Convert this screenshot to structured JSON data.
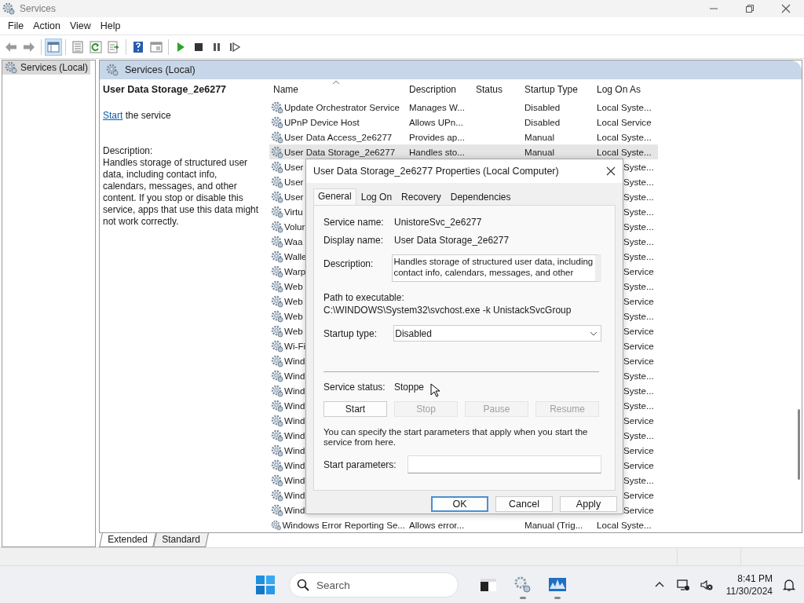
{
  "window": {
    "title": "Services"
  },
  "menu": [
    "File",
    "Action",
    "View",
    "Help"
  ],
  "toolbar": [
    {
      "kind": "back",
      "selected": false
    },
    {
      "kind": "forward",
      "selected": false
    },
    {
      "kind": "tree",
      "selected": true
    },
    {
      "kind": "list",
      "selected": false
    },
    {
      "kind": "refresh",
      "selected": false
    },
    {
      "kind": "export",
      "selected": false
    },
    {
      "kind": "help",
      "selected": false
    },
    {
      "kind": "view",
      "selected": false
    },
    {
      "kind": "play",
      "selected": false
    },
    {
      "kind": "stop",
      "selected": false
    },
    {
      "kind": "pause",
      "selected": false
    },
    {
      "kind": "resume",
      "selected": false
    }
  ],
  "tree": [
    {
      "label": "Services (Local)",
      "selected": true
    }
  ],
  "details": {
    "header": "Services (Local)",
    "service_title": "User Data Storage_2e6277",
    "action_link": "Start",
    "action_text": "the service",
    "description_label": "Description:",
    "description": "Handles storage of structured user data, including contact info, calendars, messages, and other content. If you stop or disable this service, apps that use this data might not work correctly."
  },
  "list": {
    "columns": [
      {
        "label": "Name",
        "sorted": true
      },
      {
        "label": "Description",
        "sorted": false
      },
      {
        "label": "Status",
        "sorted": false
      },
      {
        "label": "Startup Type",
        "sorted": false
      },
      {
        "label": "Log On As",
        "sorted": false
      }
    ],
    "rows": [
      {
        "kind": "full",
        "name": "Update Orchestrator Service",
        "description": "Manages W...",
        "startup": "Disabled",
        "logon": "Local Syste...",
        "selected": false
      },
      {
        "kind": "full",
        "name": "UPnP Device Host",
        "description": "Allows UPn...",
        "startup": "Disabled",
        "logon": "Local Service",
        "selected": false
      },
      {
        "kind": "full",
        "name": "User Data Access_2e6277",
        "description": "Provides ap...",
        "startup": "Manual",
        "logon": "Local Syste...",
        "selected": false
      },
      {
        "kind": "full",
        "name": "User Data Storage_2e6277",
        "description": "Handles sto...",
        "startup": "Manual",
        "logon": "Local Syste...",
        "selected": true
      },
      {
        "kind": "covered",
        "name": "User",
        "logon": "Syste...",
        "selected": false
      },
      {
        "kind": "covered",
        "name": "User",
        "logon": "Syste...",
        "selected": false
      },
      {
        "kind": "covered",
        "name": "User",
        "logon": "Syste...",
        "selected": false
      },
      {
        "kind": "covered",
        "name": "Virtu",
        "logon": "Syste...",
        "selected": false
      },
      {
        "kind": "covered",
        "name": "Volur",
        "logon": "Syste...",
        "selected": false
      },
      {
        "kind": "covered",
        "name": "Waa",
        "logon": "Syste...",
        "selected": false
      },
      {
        "kind": "covered",
        "name": "Walle",
        "logon": "Syste...",
        "selected": false
      },
      {
        "kind": "covered",
        "name": "Warp",
        "logon": "Service",
        "selected": false
      },
      {
        "kind": "covered",
        "name": "Web",
        "logon": "Syste...",
        "selected": false
      },
      {
        "kind": "covered",
        "name": "Web",
        "logon": "Service",
        "selected": false
      },
      {
        "kind": "covered",
        "name": "Web",
        "logon": "Syste...",
        "selected": false
      },
      {
        "kind": "covered",
        "name": "Web",
        "logon": "Service",
        "selected": false
      },
      {
        "kind": "covered",
        "name": "Wi-Fi",
        "logon": "Service",
        "selected": false
      },
      {
        "kind": "covered",
        "name": "Wind",
        "logon": "Service",
        "selected": false
      },
      {
        "kind": "covered",
        "name": "Wind",
        "logon": "Syste...",
        "selected": false
      },
      {
        "kind": "covered",
        "name": "Wind",
        "logon": "Syste...",
        "selected": false
      },
      {
        "kind": "covered",
        "name": "Wind",
        "logon": "Syste...",
        "selected": false
      },
      {
        "kind": "covered",
        "name": "Wind",
        "logon": "Service",
        "selected": false
      },
      {
        "kind": "covered",
        "name": "Wind",
        "logon": "Syste...",
        "selected": false
      },
      {
        "kind": "covered",
        "name": "Wind",
        "logon": "Service",
        "selected": false
      },
      {
        "kind": "covered",
        "name": "Wind",
        "logon": "Service",
        "selected": false
      },
      {
        "kind": "covered",
        "name": "Wind",
        "logon": "Syste...",
        "selected": false
      },
      {
        "kind": "covered",
        "name": "Wind",
        "logon": "Service",
        "selected": false
      },
      {
        "kind": "covered",
        "name": "Wind",
        "logon": "Service",
        "selected": false
      },
      {
        "kind": "full",
        "name": "Windows Error Reporting Se...",
        "description": "Allows error...",
        "startup": "Manual (Trig...",
        "logon": "Local Syste...",
        "selected": false
      }
    ]
  },
  "view_tabs": [
    {
      "label": "Extended",
      "selected": true
    },
    {
      "label": "Standard",
      "selected": false
    }
  ],
  "dialog": {
    "title": "User Data Storage_2e6277 Properties (Local Computer)",
    "tabs": [
      {
        "label": "General",
        "selected": true
      },
      {
        "label": "Log On",
        "selected": false
      },
      {
        "label": "Recovery",
        "selected": false
      },
      {
        "label": "Dependencies",
        "selected": false
      }
    ],
    "service_name_label": "Service name:",
    "service_name": "UnistoreSvc_2e6277",
    "display_name_label": "Display name:",
    "display_name": "User Data Storage_2e6277",
    "description_label": "Description:",
    "description": "Handles storage of structured user data, including contact info, calendars, messages, and other",
    "path_label": "Path to executable:",
    "path": "C:\\WINDOWS\\System32\\svchost.exe -k UnistackSvcGroup",
    "startup_label": "Startup type:",
    "startup_value": "Disabled",
    "status_label": "Service status:",
    "status_value": "Stoppe",
    "service_buttons": [
      {
        "label": "Start",
        "disabled": false
      },
      {
        "label": "Stop",
        "disabled": true
      },
      {
        "label": "Pause",
        "disabled": true
      },
      {
        "label": "Resume",
        "disabled": true
      }
    ],
    "hint": "You can specify the start parameters that apply when you start the service from here.",
    "params_label": "Start parameters:",
    "buttons": [
      {
        "label": "OK",
        "default": true
      },
      {
        "label": "Cancel",
        "default": false
      },
      {
        "label": "Apply",
        "default": false
      }
    ]
  },
  "taskbar": {
    "search_placeholder": "Search",
    "apps": [
      {
        "kind": "terminal",
        "running": false
      },
      {
        "kind": "services",
        "running": true
      },
      {
        "kind": "monitor",
        "running": true
      }
    ],
    "time": "8:41 PM",
    "date": "11/30/2024"
  }
}
